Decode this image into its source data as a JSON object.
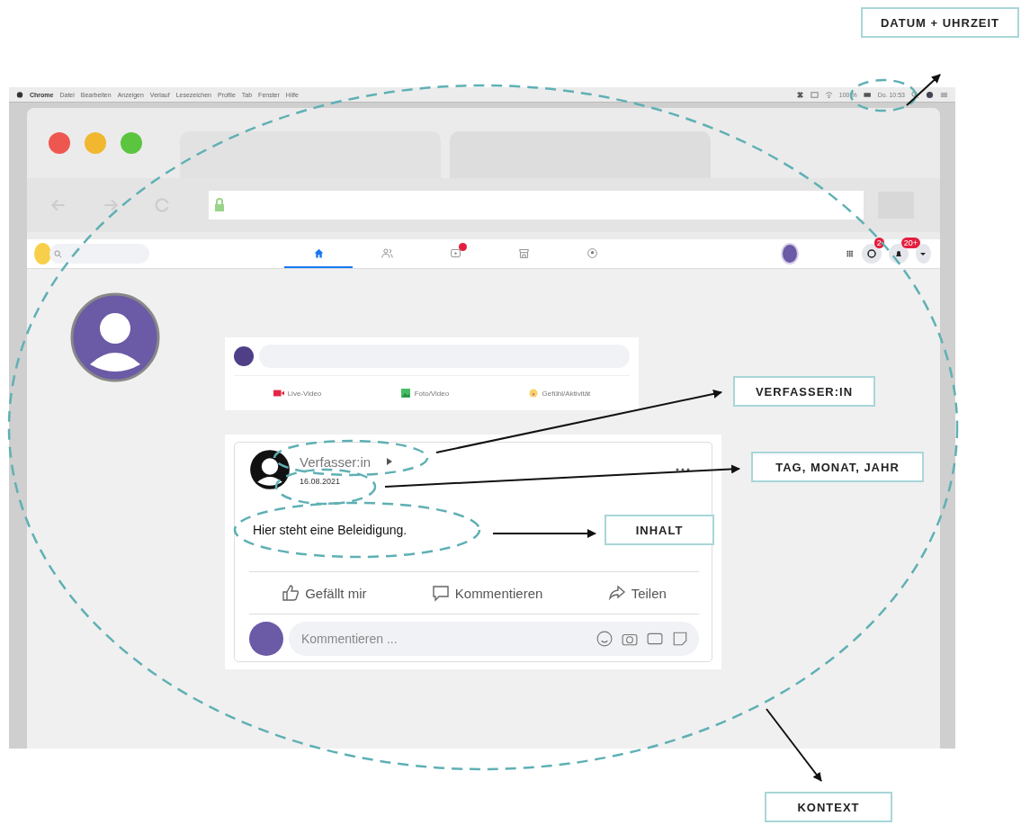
{
  "menubar": {
    "items": [
      "Chrome",
      "Datei",
      "Bearbeiten",
      "Anzeigen",
      "Verlauf",
      "Lesezeichen",
      "Profile",
      "Tab",
      "Fenster",
      "Hilfe"
    ],
    "battery": "100 %",
    "clock": "Do. 10:53"
  },
  "navbar": {
    "tabs": [
      {
        "kind": "home",
        "selected": true
      },
      {
        "kind": "friends",
        "selected": false
      },
      {
        "kind": "video",
        "selected": false,
        "dot": true
      },
      {
        "kind": "market",
        "selected": false
      },
      {
        "kind": "groups",
        "selected": false
      }
    ],
    "badges": [
      {
        "kind": "messenger",
        "badge": "2"
      },
      {
        "kind": "bell",
        "badge": "20+"
      }
    ]
  },
  "composer": {
    "actions": [
      {
        "kind": "live",
        "label": "Live-Video"
      },
      {
        "kind": "photo",
        "label": "Foto/Video"
      },
      {
        "kind": "feeling",
        "label": "Gefühl/Aktivität"
      }
    ]
  },
  "post": {
    "author": "Verfasser:in",
    "date": "16.08.2021",
    "text": "Hier steht eine Beleidigung.",
    "actions": [
      {
        "kind": "like",
        "label": "Gefällt mir"
      },
      {
        "kind": "comment",
        "label": "Kommentieren"
      },
      {
        "kind": "share",
        "label": "Teilen"
      }
    ],
    "comment_placeholder": "Kommentieren ..."
  },
  "annotations": [
    {
      "kind": "datetime",
      "label": "DATUM + UHRZEIT"
    },
    {
      "kind": "author",
      "label": "VERFASSER:IN"
    },
    {
      "kind": "date",
      "label": "TAG, MONAT, JAHR"
    },
    {
      "kind": "content",
      "label": "INHALT"
    },
    {
      "kind": "context",
      "label": "KONTEXT"
    }
  ]
}
